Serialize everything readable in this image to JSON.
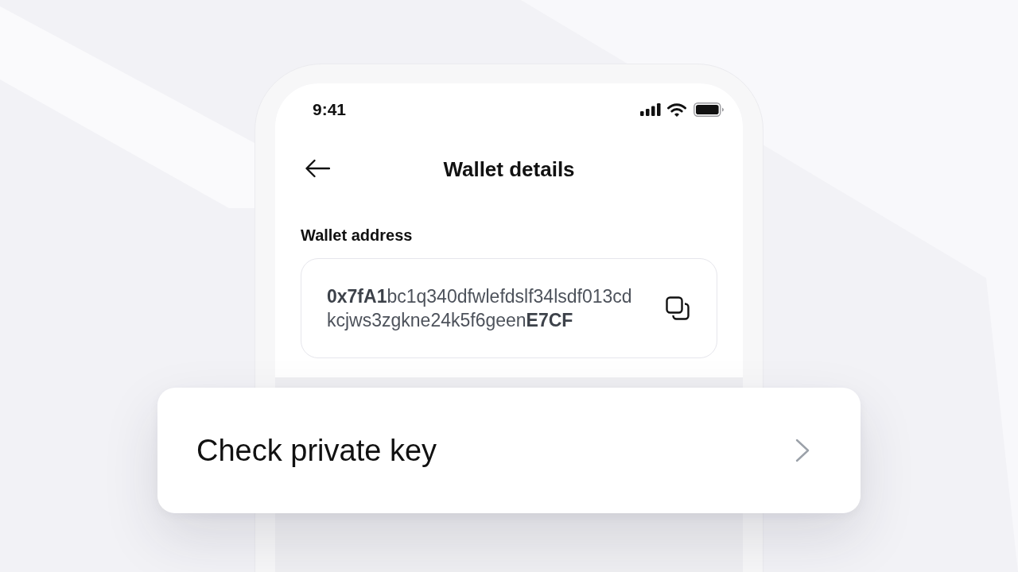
{
  "status_bar": {
    "time": "9:41"
  },
  "header": {
    "title": "Wallet details"
  },
  "wallet_address": {
    "label": "Wallet address",
    "lines": [
      "**0x7fA1**bc1q340dfwlefdslf34lsdf013cd",
      "kcjws3zgkne24k5f6geen**E7CF**"
    ]
  },
  "menu_items": [
    {
      "label": "Check private key"
    }
  ]
}
